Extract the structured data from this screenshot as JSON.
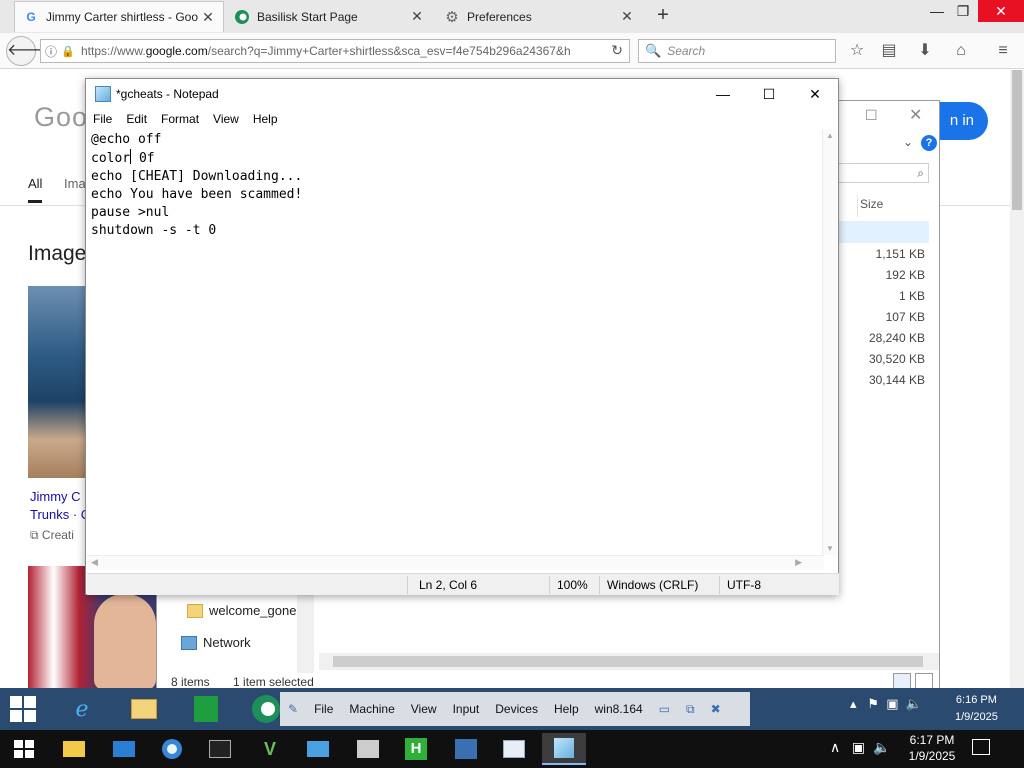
{
  "browser": {
    "tabs": [
      {
        "title": "Jimmy Carter shirtless - Goo",
        "icon": "G",
        "active": true
      },
      {
        "title": "Basilisk Start Page",
        "icon": "basilisk-icon",
        "active": false
      },
      {
        "title": "Preferences",
        "icon": "gear-icon",
        "active": false
      }
    ],
    "url_prefix": "https://www.",
    "url_host": "google.com",
    "url_rest": "/search?q=Jimmy+Carter+shirtless&sca_esv=f4e754b296a24367&h",
    "search_placeholder": "Search"
  },
  "google": {
    "logo": "Goo",
    "tab_all": "All",
    "tab_images": "Ima",
    "images_heading": "Image",
    "caption_line1": "Jimmy C",
    "caption_line2": "Trunks · C",
    "source": "Creati",
    "signin": "n in"
  },
  "explorer": {
    "size_header": "Size",
    "sizes": [
      "1,151 KB",
      "192 KB",
      "1 KB",
      "107 KB",
      "28,240 KB",
      "30,520 KB",
      "30,144 KB"
    ],
    "nav_items": [
      "welcome_gone",
      "Network"
    ],
    "status_items": "8 items",
    "status_selected": "1 item selected"
  },
  "notepad": {
    "title": "*gcheats - Notepad",
    "menu": [
      "File",
      "Edit",
      "Format",
      "View",
      "Help"
    ],
    "lines": [
      "@echo off",
      "color 0f",
      "echo [CHEAT] Downloading...",
      "echo You have been scammed!",
      "pause >nul",
      "shutdown -s -t 0"
    ],
    "status": {
      "position": "Ln 2, Col 6",
      "zoom": "100%",
      "line_ending": "Windows (CRLF)",
      "encoding": "UTF-8"
    }
  },
  "vm": {
    "menu": [
      "File",
      "Machine",
      "View",
      "Input",
      "Devices",
      "Help"
    ],
    "machine_name": "win8.164",
    "clock_time": "6:16 PM",
    "clock_date": "1/9/2025"
  },
  "taskbar": {
    "clock_time": "6:17 PM",
    "clock_date": "1/9/2025"
  },
  "colors": {
    "accent": "#1a73e8",
    "close_red": "#e81123",
    "vm_taskbar": "#2b4a6f"
  }
}
